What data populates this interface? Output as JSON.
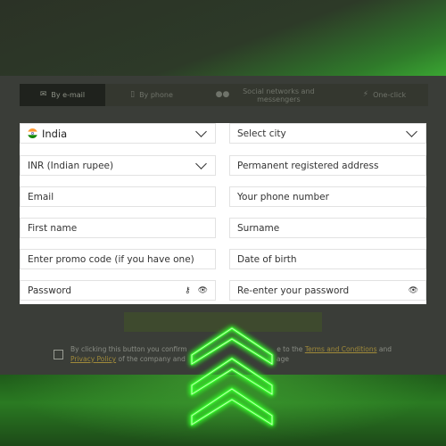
{
  "tabs": [
    {
      "label": "By e-mail",
      "icon": "envelope-icon",
      "active": true
    },
    {
      "label": "By phone",
      "icon": "phone-icon",
      "active": false
    },
    {
      "label": "Social networks and messengers",
      "icon": "people-icon",
      "active": false
    },
    {
      "label": "One-click",
      "icon": "lightning-icon",
      "active": false
    }
  ],
  "form": {
    "country": "India",
    "city_placeholder": "Select city",
    "currency": "INR (Indian rupee)",
    "address_placeholder": "Permanent registered address",
    "email_placeholder": "Email",
    "phone_placeholder": "Your phone number",
    "first_name_placeholder": "First name",
    "surname_placeholder": "Surname",
    "promo_placeholder": "Enter promo code (if you have one)",
    "dob_placeholder": "Date of birth",
    "password_placeholder": "Password",
    "repassword_placeholder": "Re-enter your password"
  },
  "consent": {
    "text_a": "By clicking this button you confirm",
    "text_b": "e to the",
    "terms_link": "Terms and Conditions",
    "text_c": "and",
    "privacy_link": "Privacy Policy",
    "text_d": "of the company and",
    "text_e": "age"
  },
  "colors": {
    "accent_green": "#39ff2e",
    "form_bg": "#ffffff",
    "panel_bg": "#3a3d38"
  }
}
